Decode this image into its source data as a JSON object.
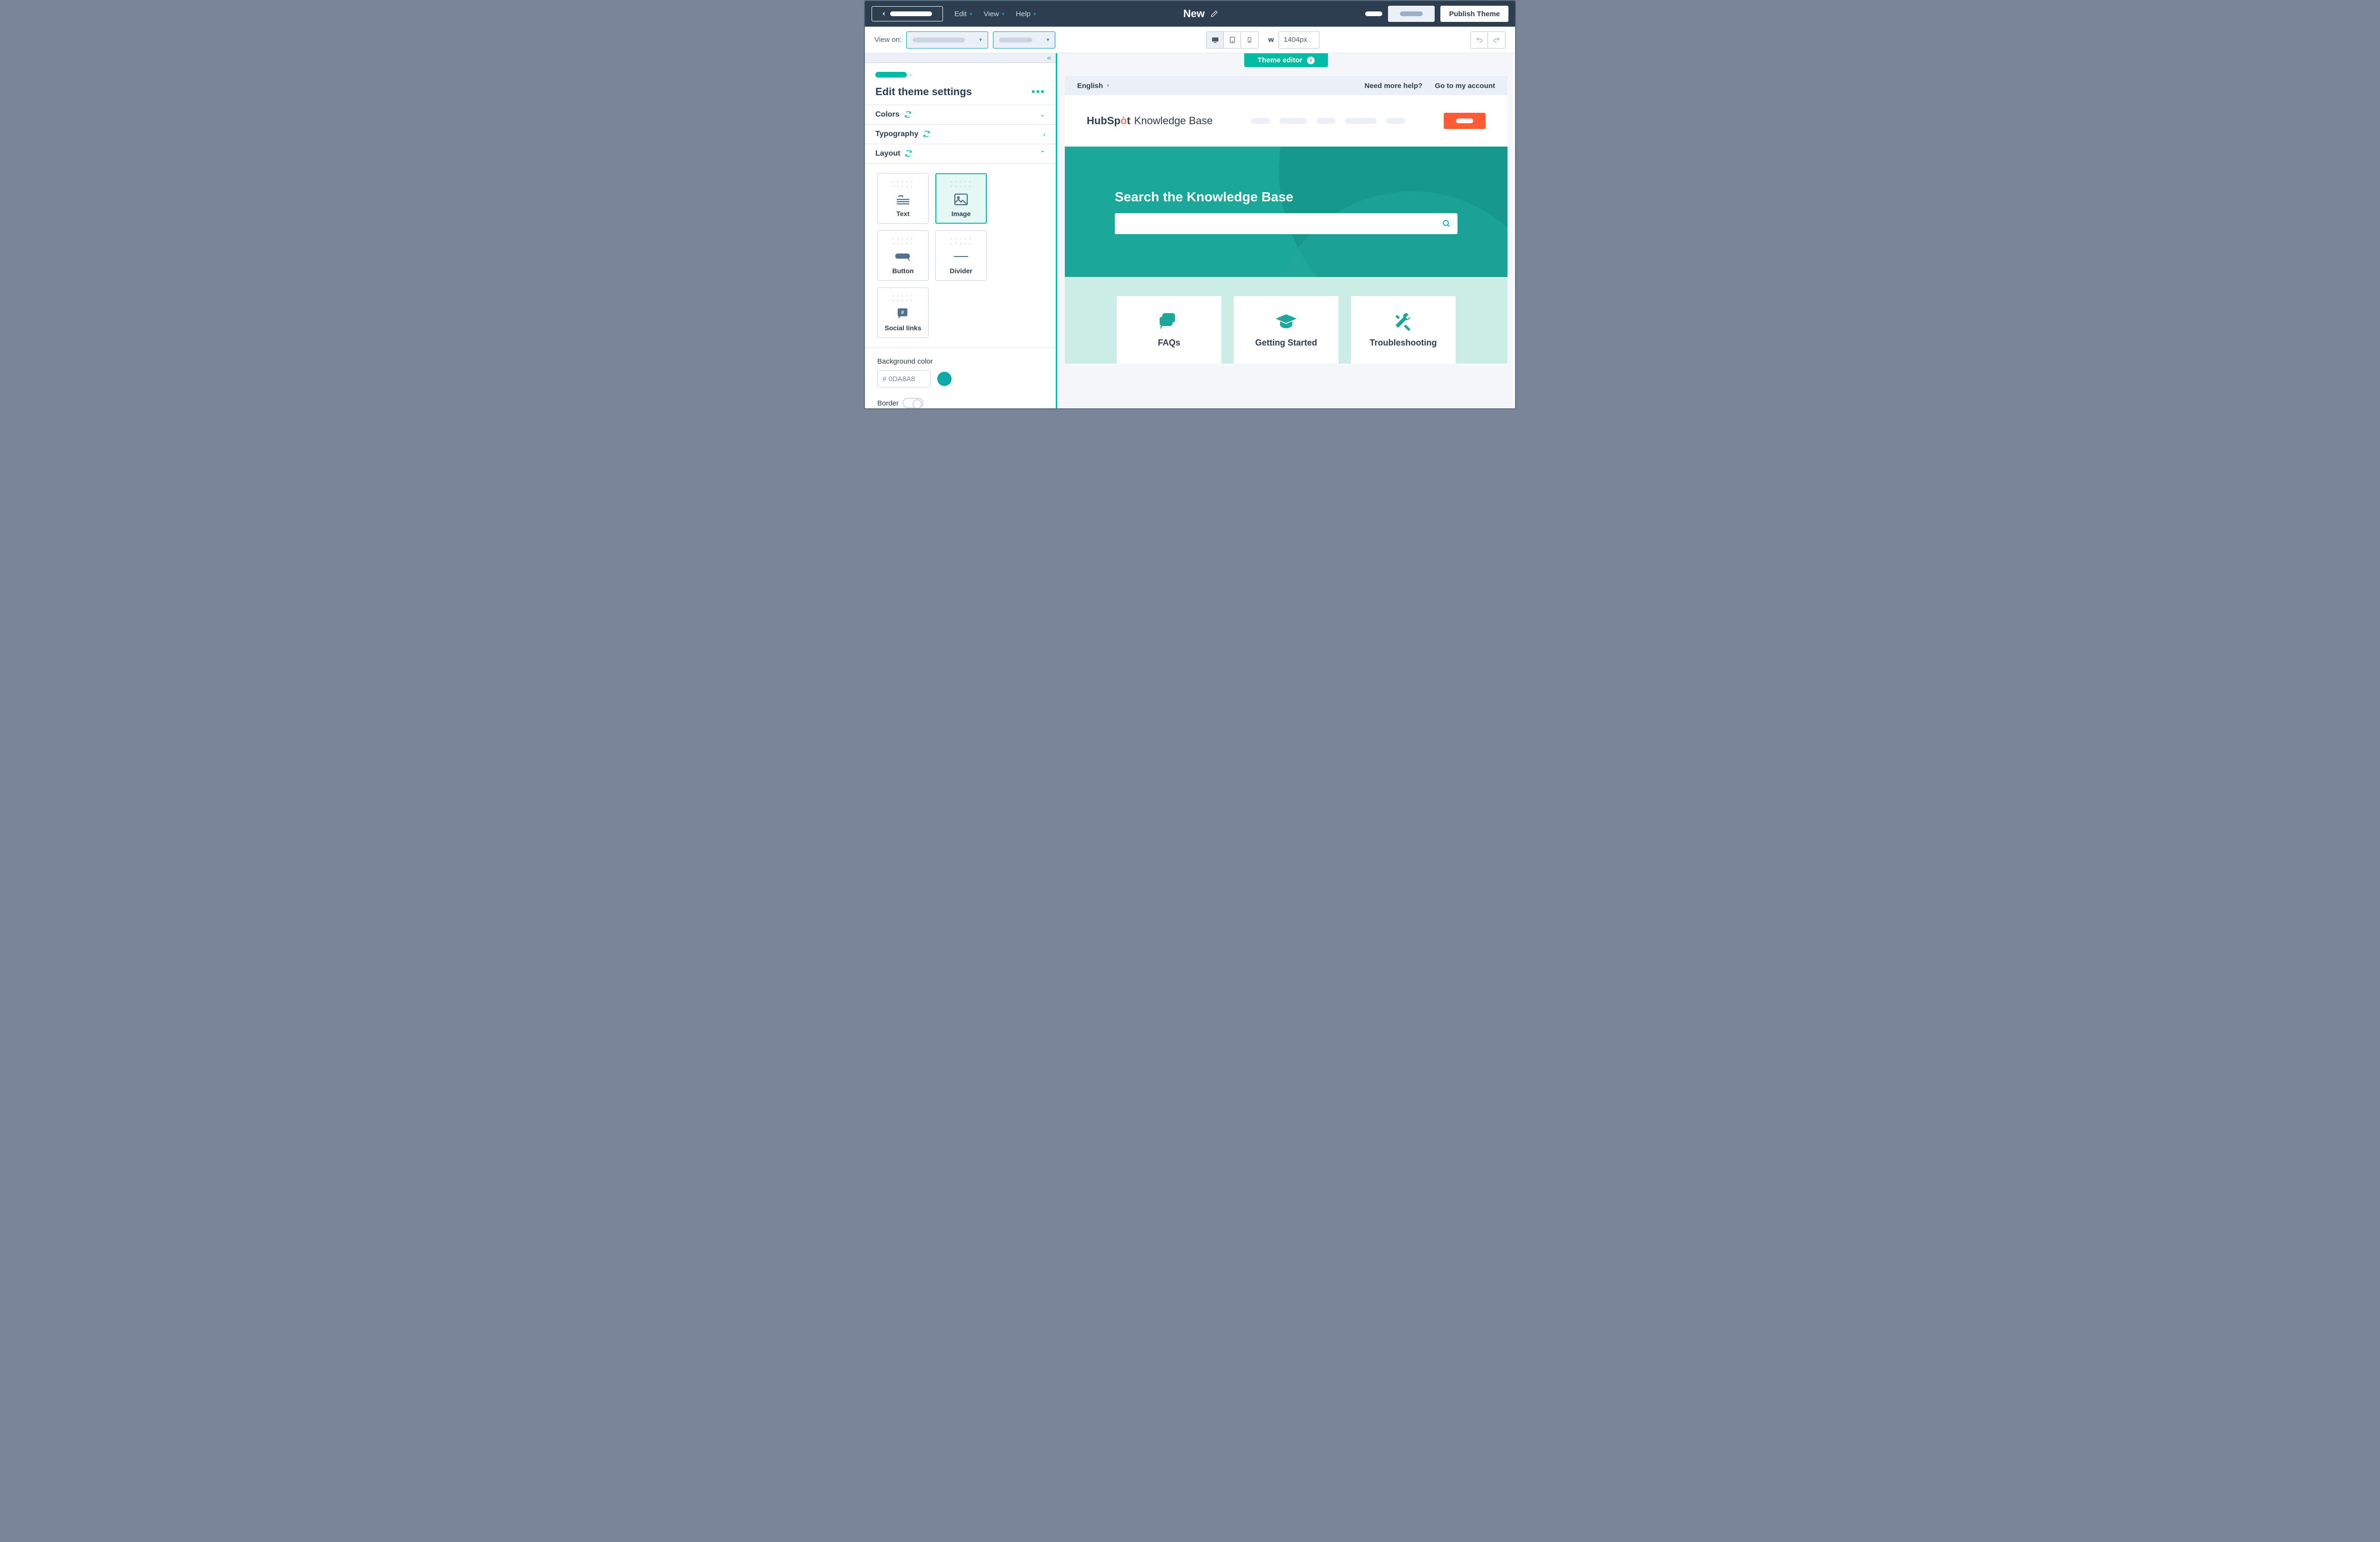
{
  "topbar": {
    "menus": [
      "Edit",
      "View",
      "Help"
    ],
    "title": "New",
    "publish": "Publish Theme"
  },
  "secondbar": {
    "view_label": "View on:",
    "width_label": "w",
    "width_value": "1404px"
  },
  "sidebar": {
    "title": "Edit theme settings",
    "accordion": {
      "colors": "Colors",
      "typography": "Typography",
      "layout": "Layout"
    },
    "components": {
      "text": "Text",
      "image": "Image",
      "button": "Button",
      "divider": "Divider",
      "social": "Social links"
    },
    "bg": {
      "label": "Background color",
      "value": "# 0DA8A8"
    },
    "border_label": "Border"
  },
  "preview": {
    "tab": "Theme editor",
    "lang": "English",
    "help_link": "Need more help?",
    "account_link": "Go to my account",
    "brand_name": "HubSpot",
    "brand_sub": "Knowledge Base",
    "hero_title": "Search the Knowledge Base",
    "cards": [
      "FAQs",
      "Getting Started",
      "Troubleshooting"
    ]
  }
}
